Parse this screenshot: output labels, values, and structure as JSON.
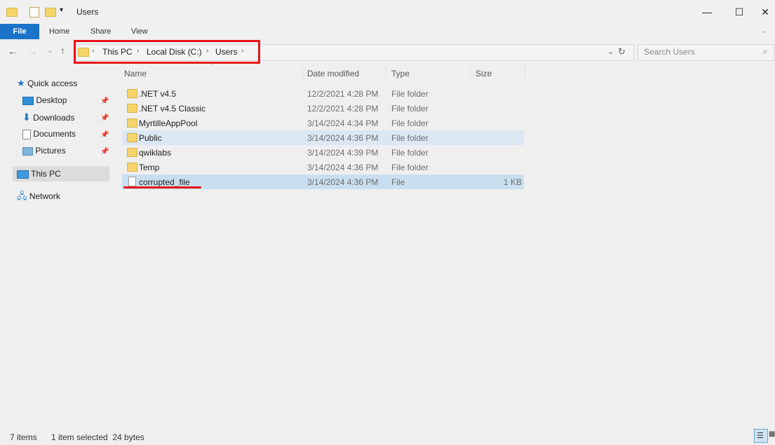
{
  "window": {
    "title": "Users",
    "controls": [
      "minimize",
      "maximize",
      "close"
    ]
  },
  "ribbon": {
    "tabs": [
      "File",
      "Home",
      "Share",
      "View"
    ]
  },
  "address": {
    "breadcrumbs": [
      "This PC",
      "Local Disk (C:)",
      "Users"
    ],
    "search_placeholder": "Search Users"
  },
  "nav_pane": {
    "quick_access": "Quick access",
    "pinned": [
      "Desktop",
      "Downloads",
      "Documents",
      "Pictures"
    ],
    "this_pc": "This PC",
    "network": "Network"
  },
  "file_list": {
    "columns": [
      "Name",
      "Date modified",
      "Type",
      "Size"
    ],
    "rows": [
      {
        "name": ".NET v4.5",
        "date": "12/2/2021 4:28 PM",
        "type": "File folder",
        "size": ""
      },
      {
        "name": ".NET v4.5 Classic",
        "date": "12/2/2021 4:28 PM",
        "type": "File folder",
        "size": ""
      },
      {
        "name": "MyrtilleAppPool",
        "date": "3/14/2024 4:34 PM",
        "type": "File folder",
        "size": ""
      },
      {
        "name": "Public",
        "date": "3/14/2024 4:36 PM",
        "type": "File folder",
        "size": ""
      },
      {
        "name": "qwiklabs",
        "date": "3/14/2024 4:39 PM",
        "type": "File folder",
        "size": ""
      },
      {
        "name": "Temp",
        "date": "3/14/2024 4:36 PM",
        "type": "File folder",
        "size": ""
      },
      {
        "name": "corrupted_file",
        "date": "3/14/2024 4:36 PM",
        "type": "File",
        "size": "1 KB"
      }
    ]
  },
  "status": {
    "count": "7 items",
    "selection": "1 item selected  24 bytes"
  },
  "colors": {
    "accent": "#1a73c8",
    "highlight": "#e8141b",
    "selected_row": "#c9dff0"
  }
}
